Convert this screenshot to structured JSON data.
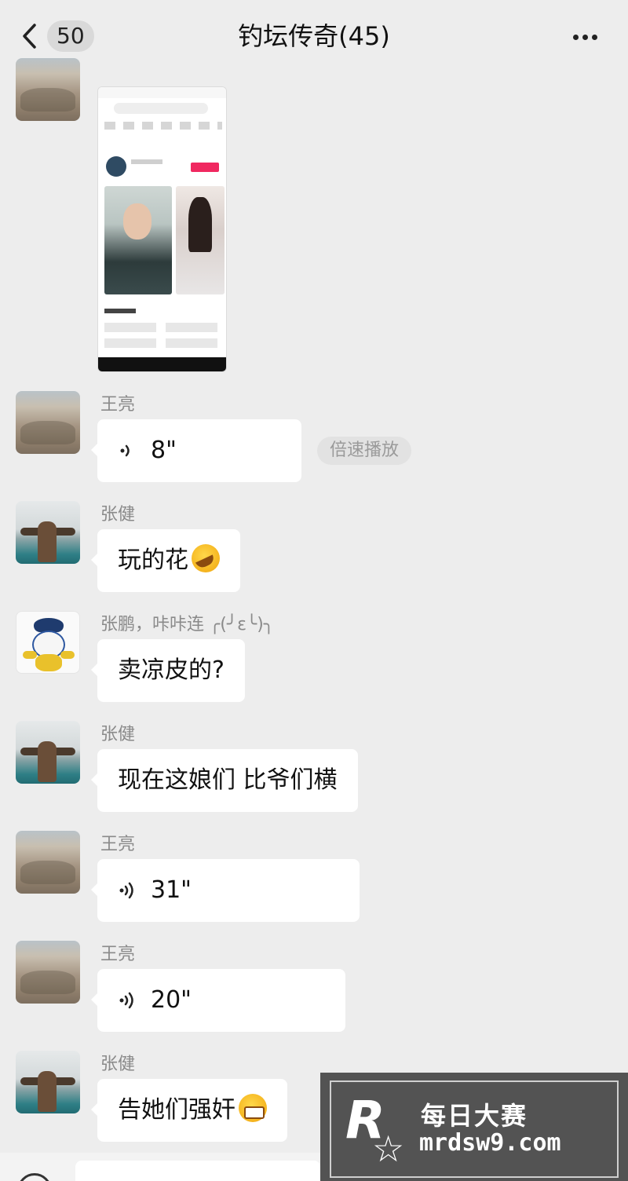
{
  "header": {
    "back_count": "50",
    "title": "钓坛传奇(45)"
  },
  "messages": [
    {
      "sender": "王亮",
      "type": "voice",
      "duration": "8\"",
      "action": "倍速播放"
    },
    {
      "sender": "张健",
      "type": "text",
      "text": "玩的花"
    },
    {
      "sender": "张鹏，咔咔连 ╭(╯ε╰)╮",
      "type": "text",
      "text": "卖凉皮的?"
    },
    {
      "sender": "张健",
      "type": "text",
      "text": "现在这娘们 比爷们横"
    },
    {
      "sender": "王亮",
      "type": "voice",
      "duration": "31\""
    },
    {
      "sender": "王亮",
      "type": "voice",
      "duration": "20\""
    },
    {
      "sender": "张健",
      "type": "text",
      "text": "告她们强奸"
    }
  ],
  "watermark": {
    "logo": "R",
    "title": "每日大赛",
    "url": "mrdsw9.com"
  },
  "icons": [
    "chevron-left-icon",
    "more-icon",
    "voice-wave-icon",
    "laugh-emoji-icon",
    "grin-emoji-icon",
    "star-icon"
  ]
}
